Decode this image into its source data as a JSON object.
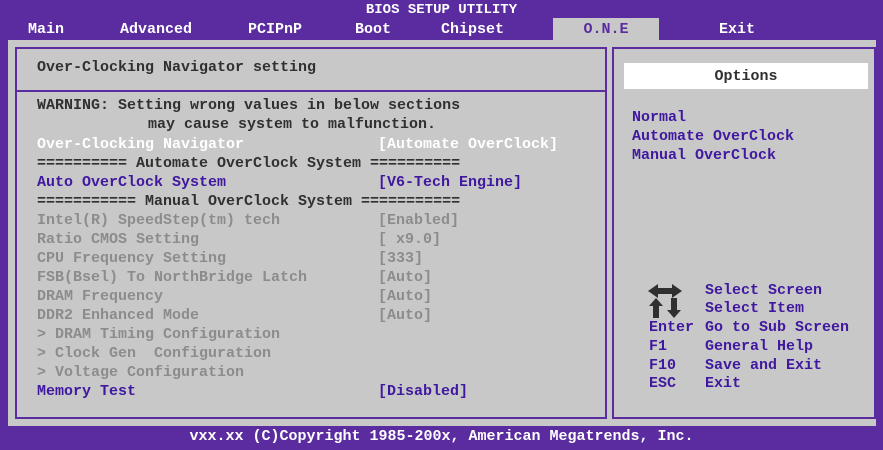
{
  "title": "BIOS SETUP UTILITY",
  "menu": [
    "Main",
    "Advanced",
    "PCIPnP",
    "Boot",
    "Chipset",
    "O.N.E",
    "Exit"
  ],
  "page_title": "Over-Clocking Navigator setting",
  "warning": {
    "line1": "WARNING: Setting wrong values in below sections",
    "line2": "may cause system to malfunction."
  },
  "settings": [
    {
      "label": "Over-Clocking Navigator",
      "value": "[Automate OverClock]"
    },
    {
      "label": "========== Automate OverClock System ==========",
      "value": ""
    },
    {
      "label": "Auto OverClock System",
      "value": "[V6-Tech Engine]"
    },
    {
      "label": "=========== Manual OverClock System ===========",
      "value": ""
    },
    {
      "label": "Intel(R) SpeedStep(tm) tech",
      "value": "[Enabled]"
    },
    {
      "label": "Ratio CMOS Setting",
      "value": "[ x9.0]"
    },
    {
      "label": "CPU Frequency Setting",
      "value": "[333]"
    },
    {
      "label": "FSB(Bsel) To NorthBridge Latch",
      "value": "[Auto]"
    },
    {
      "label": "DRAM Frequency",
      "value": "[Auto]"
    },
    {
      "label": "DDR2 Enhanced Mode",
      "value": "[Auto]"
    },
    {
      "label": "> DRAM Timing Configuration",
      "value": ""
    },
    {
      "label": "> Clock Gen  Configuration",
      "value": ""
    },
    {
      "label": "> Voltage Configuration",
      "value": ""
    },
    {
      "label": "Memory Test",
      "value": "[Disabled]"
    }
  ],
  "options": {
    "title": "Options",
    "items": [
      "Normal",
      "Automate OverClock",
      "Manual OverClock"
    ]
  },
  "help": {
    "select_screen": "Select Screen",
    "select_item": "Select Item",
    "enter_key": "Enter",
    "enter_desc": "Go to Sub Screen",
    "f1_key": "F1",
    "f1_desc": "General Help",
    "f10_key": "F10",
    "f10_desc": "Save and Exit",
    "esc_key": "ESC",
    "esc_desc": "Exit"
  },
  "footer": "vxx.xx (C)Copyright 1985-200x, American Megatrends, Inc.",
  "colors": {
    "background": "#5a2ca0",
    "panel": "#c8c8c8",
    "highlight": "#ffffff",
    "active_text": "#4018a0",
    "inactive_text": "#8c8c8c"
  },
  "icons": [
    "left-right-arrow-icon",
    "up-down-arrow-icon"
  ]
}
